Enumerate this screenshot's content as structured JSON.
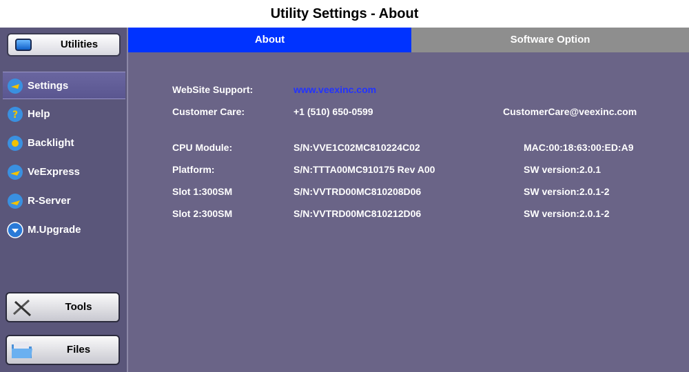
{
  "page_title": "Utility Settings - About",
  "sidebar": {
    "utilities_label": "Utilities",
    "items": [
      {
        "label": "Settings",
        "icon": "settings-icon",
        "selected": true
      },
      {
        "label": "Help",
        "icon": "help-icon"
      },
      {
        "label": "Backlight",
        "icon": "backlight-icon"
      },
      {
        "label": "VeExpress",
        "icon": "veexpress-icon"
      },
      {
        "label": "R-Server",
        "icon": "r-server-icon"
      },
      {
        "label": "M.Upgrade",
        "icon": "upgrade-icon"
      }
    ],
    "tools_label": "Tools",
    "files_label": "Files"
  },
  "tabs": [
    {
      "label": "About",
      "active": true
    },
    {
      "label": "Software Option",
      "active": false
    }
  ],
  "about": {
    "website_label": "WebSite Support:",
    "website_value": "www.veexinc.com",
    "care_label": "Customer Care:",
    "care_phone": "+1 (510) 650-0599",
    "care_email": "CustomerCare@veexinc.com",
    "modules": [
      {
        "name": "CPU Module:",
        "sn": "S/N:VVE1C02MC810224C02",
        "info": "MAC:00:18:63:00:ED:A9"
      },
      {
        "name": "Platform:",
        "sn": "S/N:TTTA00MC910175 Rev A00",
        "info": "SW version:2.0.1"
      },
      {
        "name": "Slot 1:300SM",
        "sn": "S/N:VVTRD00MC810208D06",
        "info": "SW version:2.0.1-2"
      },
      {
        "name": "Slot 2:300SM",
        "sn": "S/N:VVTRD00MC810212D06",
        "info": "SW version:2.0.1-2"
      }
    ]
  },
  "colors": {
    "background": "#6a6487",
    "tab_active": "#0033ff",
    "tab_inactive": "#8e8e8e",
    "link": "#2233ff"
  }
}
